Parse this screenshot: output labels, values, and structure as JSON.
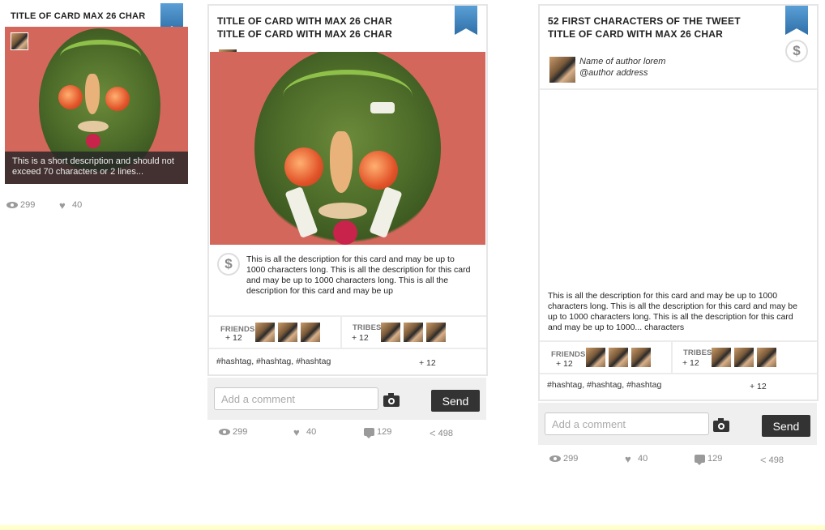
{
  "small_card": {
    "title": "TITLE OF CARD MAX 26 CHAR",
    "short_description": "This is a short description and should not exceed 70 characters or 2 lines...",
    "stats": {
      "views": "299",
      "likes": "40"
    }
  },
  "image_card": {
    "title_line1": "TITLE OF CARD WITH MAX 26 CHAR",
    "title_line2": "TITLE OF CARD WITH MAX 26 CHAR",
    "currency_symbol": "$",
    "description": "This is all the description for this card and may be up to 1000 characters long. This is all the description for this card and may be up to 1000 characters long. This is all the description for this card and may be up",
    "friends_label": "FRIENDS",
    "friends_count": "+ 12",
    "tribes_label": "TRIBES",
    "tribes_count": "+ 12",
    "hashtags": "#hashtag,  #hashtag,  #hashtag",
    "hashtags_more": "+ 12",
    "comment_placeholder": "Add a comment",
    "send_label": "Send",
    "stats": {
      "views": "299",
      "likes": "40",
      "comments": "129",
      "shares": "498"
    }
  },
  "tweet_card": {
    "title_line1": "52 FIRST CHARACTERS OF THE TWEET",
    "title_line2": "TITLE OF CARD WITH MAX 26 CHAR",
    "currency_symbol": "$",
    "author_name": "Name of author lorem",
    "author_handle": "@author address",
    "description": "This is all the description for this card and may be up to 1000 characters long. This is all the description for this card and may be up to 1000 characters long. This is all the description for this card and may be up to 1000... characters",
    "friends_label": "FRIENDS",
    "friends_count": "+ 12",
    "tribes_label": "TRIBES",
    "tribes_count": "+ 12",
    "hashtags": "#hashtag,  #hashtag,  #hashtag",
    "hashtags_more": "+ 12",
    "comment_placeholder": "Add a comment",
    "send_label": "Send",
    "stats": {
      "views": "299",
      "likes": "40",
      "comments": "129",
      "shares": "498"
    }
  },
  "colors": {
    "ribbon": "#3a7fbd",
    "artwork_bg": "#d4675c",
    "send_button": "#333333",
    "comment_bar": "#efefef"
  }
}
